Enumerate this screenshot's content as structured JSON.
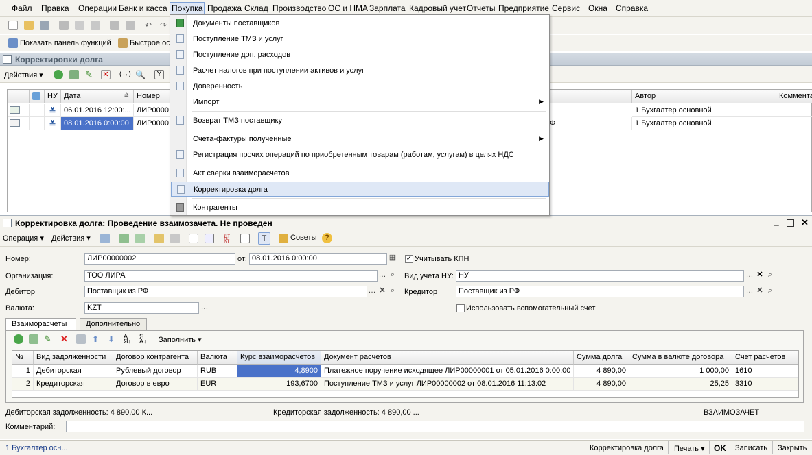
{
  "menubar": [
    "Файл",
    "Правка",
    "Операции",
    "Банк и касса",
    "Покупка",
    "Продажа",
    "Склад",
    "Производство",
    "ОС и НМА",
    "Зарплата",
    "Кадровый учет",
    "Отчеты",
    "Предприятие",
    "Сервис",
    "Окна",
    "Справка"
  ],
  "toolbar2": {
    "show_panel": "Показать панель функций",
    "quick": "Быстрое ос"
  },
  "list_window": {
    "title": "Корректировки долга",
    "actions": "Действия",
    "columns": [
      "НУ",
      "Дата",
      "Номер",
      "Автор",
      "Коммента"
    ],
    "rows": [
      {
        "date": "06.01.2016 12:00:...",
        "number": "ЛИР0000",
        "author": "1 Бухгалтер основной",
        "tail": ""
      },
      {
        "date": "08.01.2016 0:00:00",
        "number": "ЛИР0000",
        "author": "1 Бухгалтер основной",
        "tail": "Ф"
      }
    ]
  },
  "dropdown": {
    "items": [
      {
        "label": "Документы поставщиков"
      },
      {
        "label": "Поступление ТМЗ и услуг"
      },
      {
        "label": "Поступление доп. расходов"
      },
      {
        "label": "Расчет налогов при поступлении активов и услуг"
      },
      {
        "label": "Доверенность"
      },
      {
        "label": "Импорт"
      },
      {
        "label": "Возврат ТМЗ поставщику"
      },
      {
        "label": "Счета-фактуры полученные"
      },
      {
        "label": "Регистрация прочих операций по приобретенным товарам (работам, услугам) в целях НДС"
      },
      {
        "label": "Акт сверки взаиморасчетов"
      },
      {
        "label": "Корректировка долга"
      },
      {
        "label": "Контрагенты"
      }
    ]
  },
  "form": {
    "title": "Корректировка долга: Проведение взаимозачета. Не проведен",
    "toolbar": {
      "operation": "Операция",
      "actions": "Действия",
      "tips": "Советы"
    },
    "number_label": "Номер:",
    "number_value": "ЛИР00000002",
    "date_label": "от:",
    "date_value": "08.01.2016  0:00:00",
    "kpn_label": "Учитывать КПН",
    "org_label": "Организация:",
    "org_value": "ТОО ЛИРА",
    "nu_label": "Вид учета НУ:",
    "nu_value": "НУ",
    "debtor_label": "Дебитор",
    "debtor_value": "Поставщик из РФ",
    "creditor_label": "Кредитор",
    "creditor_value": "Поставщик из РФ",
    "currency_label": "Валюта:",
    "currency_value": "KZT",
    "aux_label": "Использовать вспомогательный счет",
    "tabs": [
      "Взаиморасчеты",
      "Дополнительно"
    ],
    "fill_label": "Заполнить",
    "table": {
      "columns": [
        "№",
        "Вид задолженности",
        "Договор контрагента",
        "Валюта",
        "Курс взаиморасчетов",
        "Документ расчетов",
        "Сумма  долга",
        "Сумма в валюте договора",
        "Счет расчетов"
      ],
      "rows": [
        {
          "n": "1",
          "kind": "Дебиторская",
          "contract": "Рублевый договор",
          "cur": "RUB",
          "rate": "4,8900",
          "doc": "Платежное поручение исходящее ЛИР00000001 от 05.01.2016 0:00:00",
          "sum": "4 890,00",
          "sum_cur": "1 000,00",
          "acc": "1610"
        },
        {
          "n": "2",
          "kind": "Кредиторская",
          "contract": "Договор в евро",
          "cur": "EUR",
          "rate": "193,6700",
          "doc": "Поступление ТМЗ и услуг ЛИР00000002 от 08.01.2016 11:13:02",
          "sum": "4 890,00",
          "sum_cur": "25,25",
          "acc": "3310"
        }
      ]
    },
    "debit_total": "Дебиторская задолженность: 4 890,00 К...",
    "credit_total": "Кредиторская задолженность: 4 890,00 ...",
    "mode": "ВЗАИМОЗАЧЕТ",
    "comment_label": "Комментарий:"
  },
  "statusbar": {
    "user": "1 Бухгалтер осн...",
    "doc": "Корректировка долга",
    "print": "Печать",
    "ok": "OK",
    "save": "Записать",
    "close": "Закрыть"
  },
  "colors": {
    "menu_bg": "#f4f3ee",
    "highlight": "#dfe8f6",
    "selected_cell": "#4a72c9"
  }
}
